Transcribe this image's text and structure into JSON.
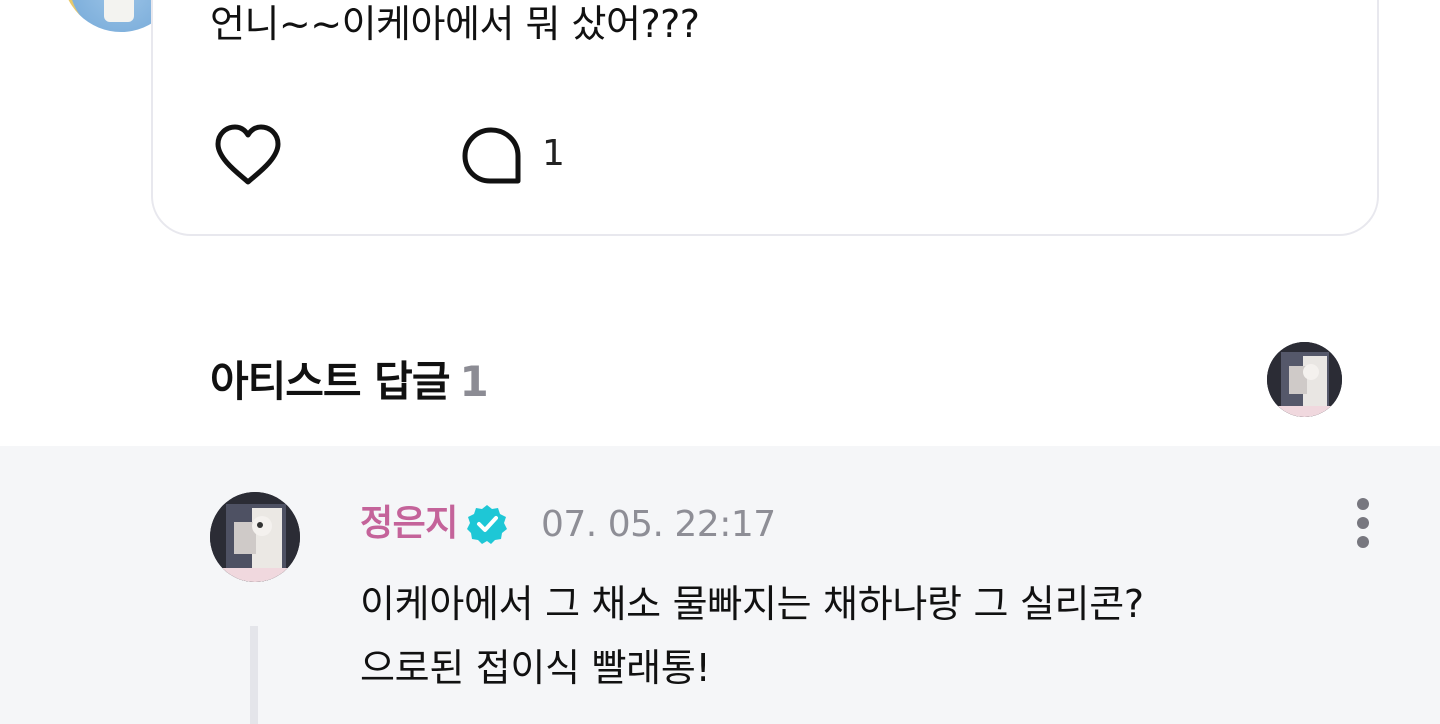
{
  "post": {
    "text": "언니~~이케아에서 뭐 샀어???",
    "comment_count": "1",
    "icons": {
      "like": "heart-icon",
      "comment": "speech-bubble-icon"
    }
  },
  "artist_replies": {
    "title": "아티스트 답글",
    "count": "1"
  },
  "reply": {
    "author": "정은지",
    "verified_icon": "verified-badge-icon",
    "timestamp": "07. 05. 22:17",
    "lines": [
      "이케아에서 그 채소 물빠지는 채하나랑 그 실리콘?",
      "으로된 접이식 빨래통!"
    ],
    "more_icon": "more-vertical-icon"
  },
  "colors": {
    "author_name": "#c4639a",
    "verified_badge": "#1ec7d6",
    "reply_background": "#f5f6f8",
    "muted_text": "#8e8e96"
  }
}
